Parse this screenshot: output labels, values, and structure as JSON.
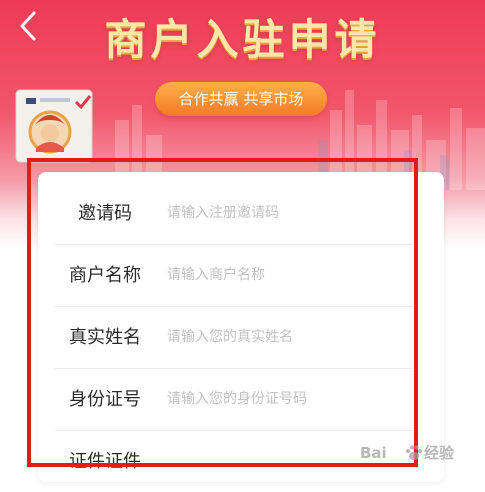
{
  "header": {
    "back_icon": "chevron-left-icon",
    "title": "商户入驻申请",
    "slogan": "合作共赢 共享市场"
  },
  "form": {
    "fields": [
      {
        "label": "邀请码",
        "placeholder": "请输入注册邀请码"
      },
      {
        "label": "商户名称",
        "placeholder": "请输入商户名称"
      },
      {
        "label": "真实姓名",
        "placeholder": "请输入您的真实姓名"
      },
      {
        "label": "身份证号",
        "placeholder": "请输入您的身份证号码"
      },
      {
        "label": "证件证件",
        "placeholder": ""
      }
    ]
  },
  "watermark": {
    "part1": "Bai",
    "part2": "经验"
  },
  "colors": {
    "banner": "#ee3b55",
    "title": "#fde7a8",
    "slogan_bg": "#f47a26",
    "highlight": "#e31b1b"
  }
}
